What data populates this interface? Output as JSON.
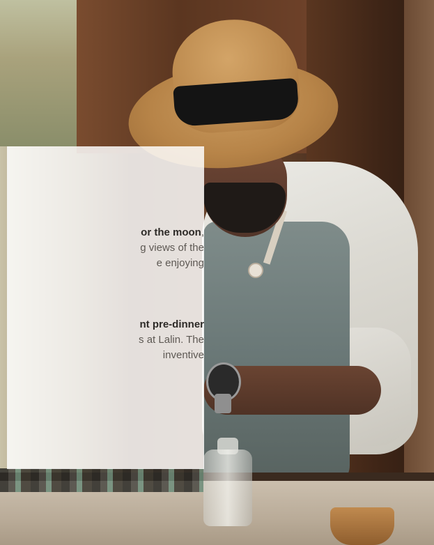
{
  "promo_panel": {
    "paragraph_1": {
      "line_1_bold": "or the moon",
      "line_1_rest": ",",
      "line_2": "g views of the",
      "line_3": "e enjoying"
    },
    "paragraph_2": {
      "line_1_bold": "nt pre-dinner",
      "line_2": "s at Lalin. The",
      "line_3": "inventive"
    }
  },
  "photo": {
    "subject": "bartender-in-straw-hat"
  }
}
